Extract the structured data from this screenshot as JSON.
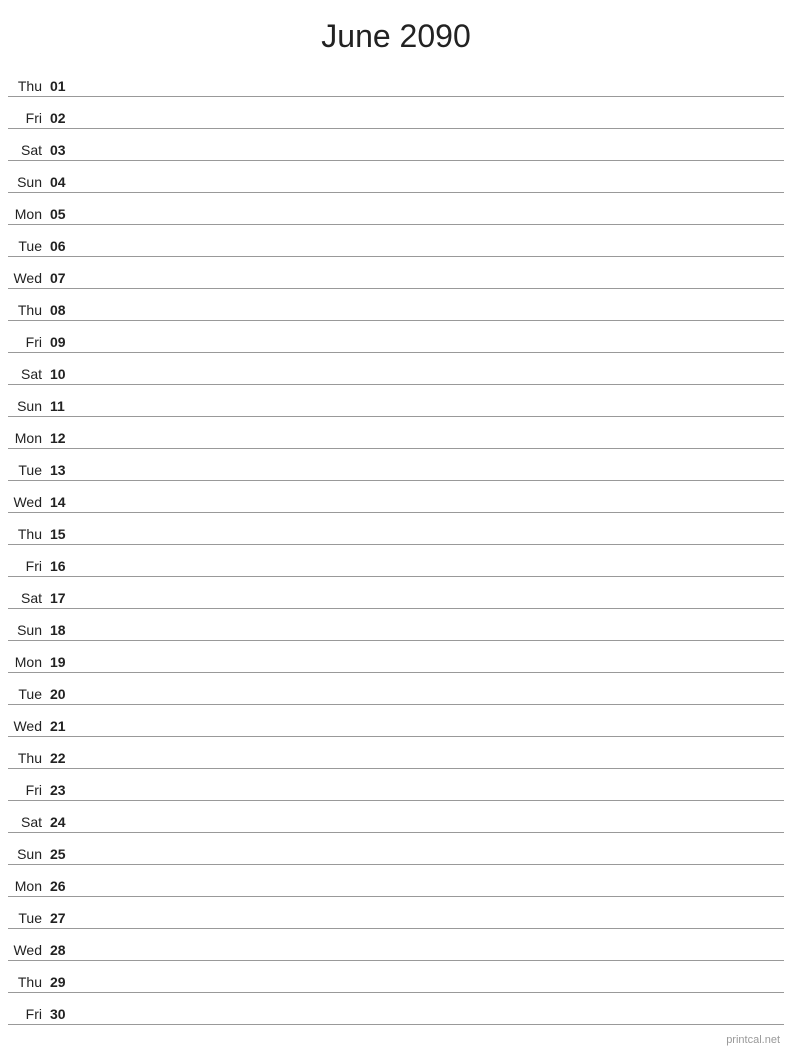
{
  "title": "June 2090",
  "days": [
    {
      "name": "Thu",
      "number": "01"
    },
    {
      "name": "Fri",
      "number": "02"
    },
    {
      "name": "Sat",
      "number": "03"
    },
    {
      "name": "Sun",
      "number": "04"
    },
    {
      "name": "Mon",
      "number": "05"
    },
    {
      "name": "Tue",
      "number": "06"
    },
    {
      "name": "Wed",
      "number": "07"
    },
    {
      "name": "Thu",
      "number": "08"
    },
    {
      "name": "Fri",
      "number": "09"
    },
    {
      "name": "Sat",
      "number": "10"
    },
    {
      "name": "Sun",
      "number": "11"
    },
    {
      "name": "Mon",
      "number": "12"
    },
    {
      "name": "Tue",
      "number": "13"
    },
    {
      "name": "Wed",
      "number": "14"
    },
    {
      "name": "Thu",
      "number": "15"
    },
    {
      "name": "Fri",
      "number": "16"
    },
    {
      "name": "Sat",
      "number": "17"
    },
    {
      "name": "Sun",
      "number": "18"
    },
    {
      "name": "Mon",
      "number": "19"
    },
    {
      "name": "Tue",
      "number": "20"
    },
    {
      "name": "Wed",
      "number": "21"
    },
    {
      "name": "Thu",
      "number": "22"
    },
    {
      "name": "Fri",
      "number": "23"
    },
    {
      "name": "Sat",
      "number": "24"
    },
    {
      "name": "Sun",
      "number": "25"
    },
    {
      "name": "Mon",
      "number": "26"
    },
    {
      "name": "Tue",
      "number": "27"
    },
    {
      "name": "Wed",
      "number": "28"
    },
    {
      "name": "Thu",
      "number": "29"
    },
    {
      "name": "Fri",
      "number": "30"
    }
  ],
  "watermark": "printcal.net"
}
